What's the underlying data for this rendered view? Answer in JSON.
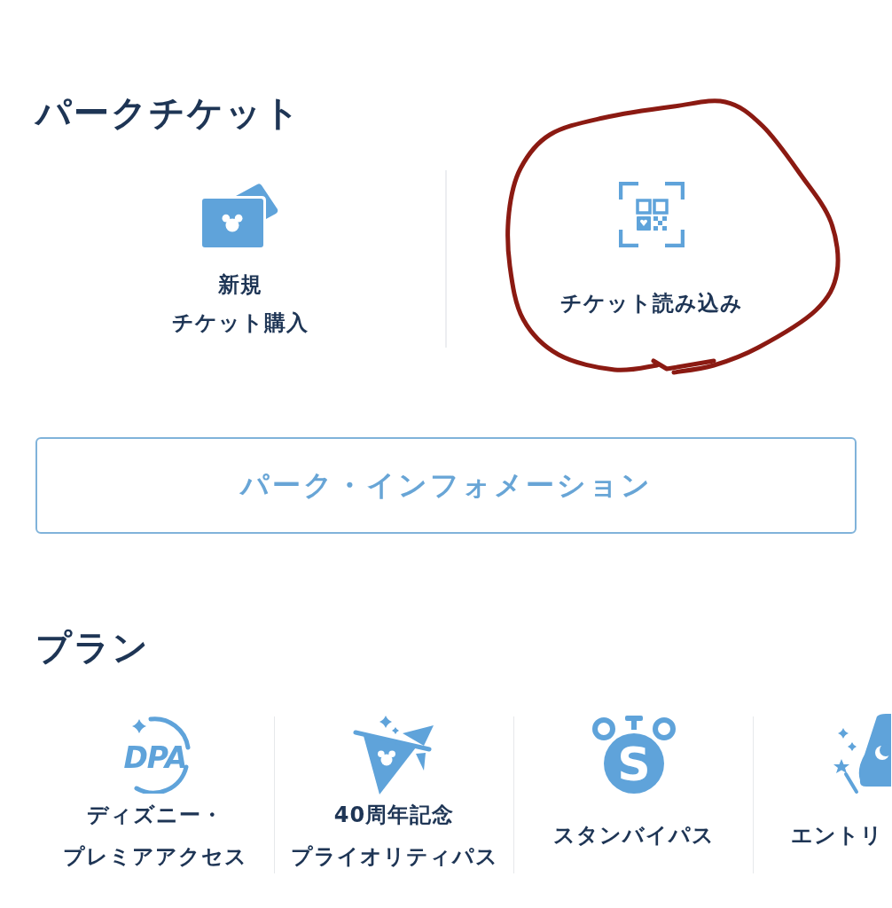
{
  "park_ticket": {
    "title": "パークチケット",
    "items": [
      {
        "kind": "tickets",
        "label_lines": [
          "新規",
          "チケット購入"
        ]
      },
      {
        "kind": "qr-scan",
        "label_lines": [
          "チケット読み込み"
        ]
      }
    ]
  },
  "info_button": {
    "label": "パーク・インフォメーション"
  },
  "plans": {
    "title": "プラン",
    "items": [
      {
        "kind": "dpa",
        "logo_text": "DPA",
        "label_lines": [
          "ディズニー・",
          "プレミアアクセス"
        ],
        "cut_off": false
      },
      {
        "kind": "pennant",
        "label_lines": [
          "40周年記念",
          "プライオリティパス"
        ],
        "cut_off": false
      },
      {
        "kind": "stopwatch",
        "icon_text": "S",
        "label_lines": [
          "スタンバイパス"
        ],
        "cut_off": false
      },
      {
        "kind": "wand-hat",
        "label_lines": [
          "エントリ"
        ],
        "cut_off": true
      }
    ]
  },
  "annotations": [
    {
      "kind": "circle"
    }
  ]
}
